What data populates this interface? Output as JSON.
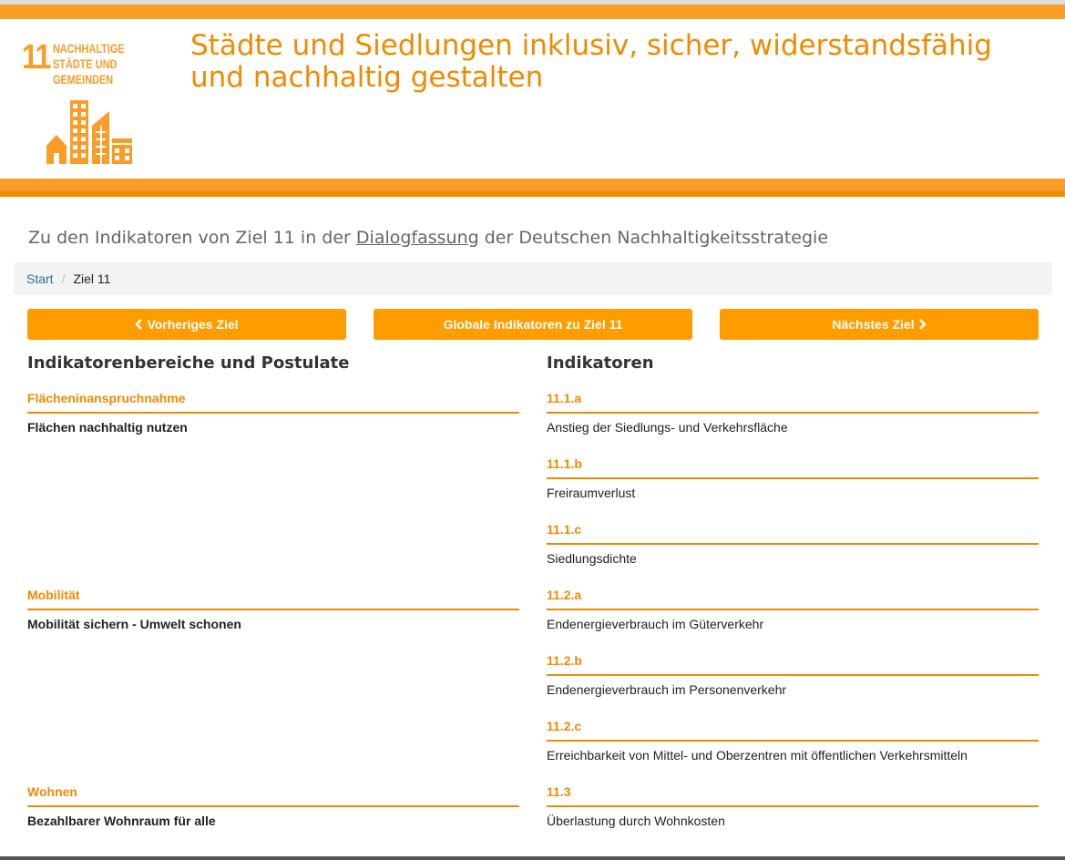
{
  "colors": {
    "accent": "#f99d26",
    "accent_dark": "#f08a00",
    "button": "#ff9d00"
  },
  "logo": {
    "number": "11",
    "text_line1": "NACHHALTIGE",
    "text_line2": "STÄDTE UND",
    "text_line3": "GEMEINDEN",
    "icon": "city-buildings-icon"
  },
  "headline": "Städte und Siedlungen inklusiv, sicher, widerstandsfähig und nachhaltig gestalten",
  "intro": {
    "prefix": "Zu den Indikatoren von Ziel 11 in der ",
    "link": "Dialogfassung",
    "suffix": " der Deutschen Nachhaltigkeitsstrategie"
  },
  "breadcrumb": {
    "home": "Start",
    "separator": "/",
    "current": "Ziel 11"
  },
  "buttons": {
    "prev": "Vorheriges Ziel",
    "global": "Globale Indikatoren zu Ziel 11",
    "next": "Nächstes Ziel"
  },
  "left_column": {
    "heading": "Indikatorenbereiche und Postulate",
    "sections": [
      {
        "title": "Flächeninanspruchnahme",
        "text": "Flächen nachhaltig nutzen"
      },
      {
        "title": "Mobilität",
        "text": "Mobilität sichern - Umwelt schonen"
      },
      {
        "title": "Wohnen",
        "text": "Bezahlbarer Wohnraum für alle"
      }
    ]
  },
  "right_column": {
    "heading": "Indikatoren",
    "indicators": [
      {
        "code": "11.1.a",
        "text": "Anstieg der Siedlungs- und Verkehrsfläche"
      },
      {
        "code": "11.1.b",
        "text": "Freiraumverlust"
      },
      {
        "code": "11.1.c",
        "text": "Siedlungsdichte"
      },
      {
        "code": "11.2.a",
        "text": "Endenergieverbrauch im Güterverkehr"
      },
      {
        "code": "11.2.b",
        "text": "Endenergieverbrauch im Personenverkehr"
      },
      {
        "code": "11.2.c",
        "text": "Erreichbarkeit von Mittel- und Oberzentren mit öffentlichen Verkehrsmitteln"
      },
      {
        "code": "11.3",
        "text": "Überlastung durch Wohnkosten"
      }
    ]
  }
}
